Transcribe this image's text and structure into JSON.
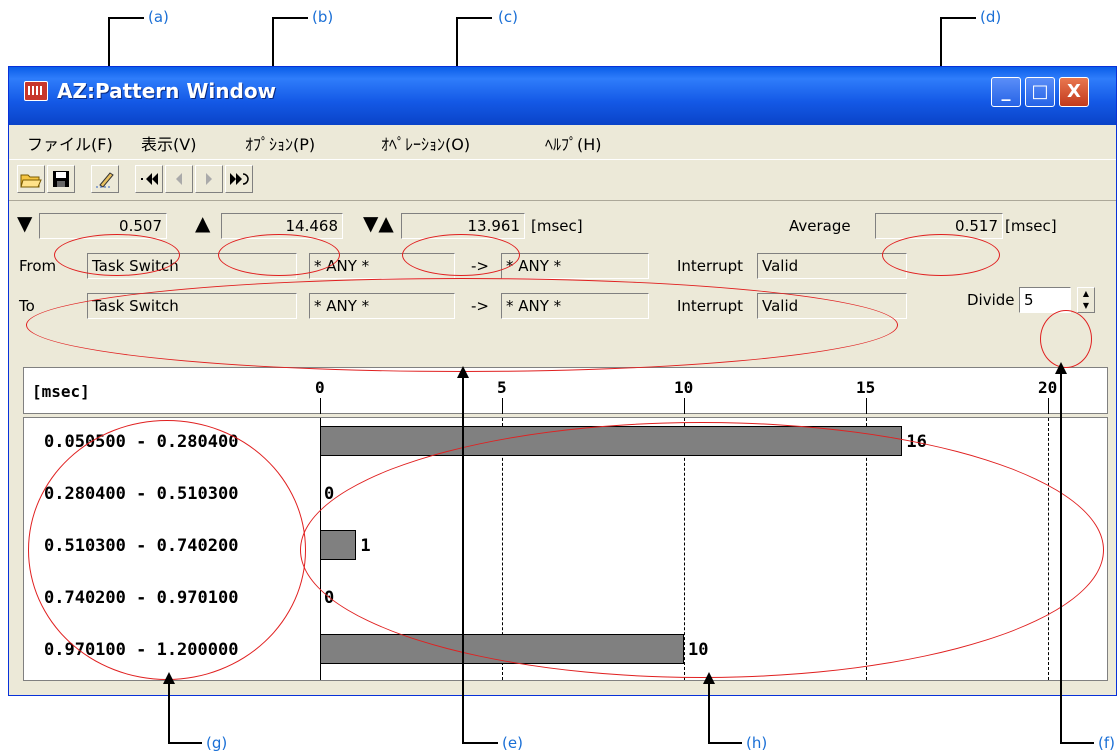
{
  "callouts": [
    "(a)",
    "(b)",
    "(c)",
    "(d)",
    "(e)",
    "(f)",
    "(g)",
    "(h)"
  ],
  "window": {
    "title": "AZ:Pattern Window",
    "buttons": {
      "minimize": "_",
      "maximize": "□",
      "close": "X"
    }
  },
  "menu": [
    "ファイル(F)",
    "表示(V)",
    "ｵﾌﾟｼｮﾝ(P)",
    "ｵﾍﾟﾚｰｼｮﾝ(O)",
    "ﾍﾙﾌﾟ(H)"
  ],
  "toolbar": {
    "icons": [
      "open-icon",
      "save-icon",
      "edit-icon",
      "first-icon",
      "previous-icon",
      "next-icon",
      "last-icon"
    ]
  },
  "times": {
    "start": "0.507",
    "end": "14.468",
    "diff": "13.961",
    "unit": "[msec]",
    "average_label": "Average",
    "average": "0.517",
    "average_unit": "[msec]"
  },
  "conditions": {
    "from": {
      "label": "From",
      "event": "Task Switch",
      "src": "* ANY *",
      "arrow": "->",
      "dst": "* ANY *",
      "interrupt_label": "Interrupt",
      "interrupt": "Valid"
    },
    "to": {
      "label": "To",
      "event": "Task Switch",
      "src": "* ANY *",
      "arrow": "->",
      "dst": "* ANY *",
      "interrupt_label": "Interrupt",
      "interrupt": "Valid"
    },
    "divide_label": "Divide",
    "divide_value": "5"
  },
  "chart_data": {
    "type": "bar",
    "orientation": "horizontal",
    "header_label": "[msec]",
    "x_ticks": [
      "0",
      "5",
      "10",
      "15",
      "20"
    ],
    "xlim": [
      0,
      20
    ],
    "grid": true,
    "categories": [
      "0.050500 - 0.280400",
      "0.280400 - 0.510300",
      "0.510300 - 0.740200",
      "0.740200 - 0.970100",
      "0.970100 - 1.200000"
    ],
    "values": [
      16,
      0,
      1,
      0,
      10
    ]
  }
}
